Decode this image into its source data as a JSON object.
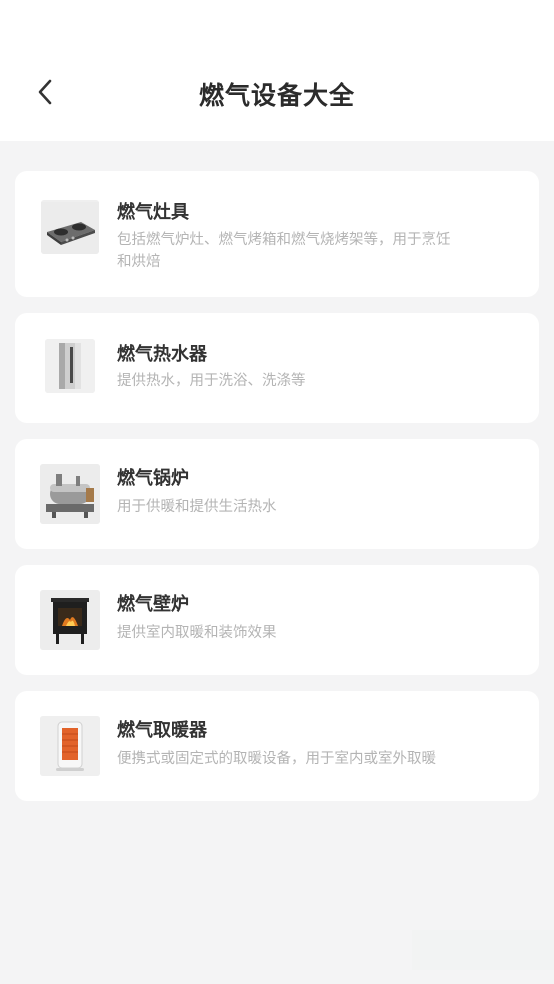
{
  "header": {
    "title": "燃气设备大全",
    "back_icon": "chevron-left-icon"
  },
  "items": [
    {
      "title": "燃气灶具",
      "desc": "包括燃气炉灶、燃气烤箱和燃气烧烤架等，用于烹饪和烘焙",
      "image": "gas-stove-image"
    },
    {
      "title": "燃气热水器",
      "desc": "提供热水，用于洗浴、洗涤等",
      "image": "gas-water-heater-image"
    },
    {
      "title": "燃气锅炉",
      "desc": "用于供暖和提供生活热水",
      "image": "gas-boiler-image"
    },
    {
      "title": "燃气壁炉",
      "desc": "提供室内取暖和装饰效果",
      "image": "gas-fireplace-image"
    },
    {
      "title": "燃气取暖器",
      "desc": "便携式或固定式的取暖设备，用于室内或室外取暖",
      "image": "gas-heater-image"
    }
  ]
}
